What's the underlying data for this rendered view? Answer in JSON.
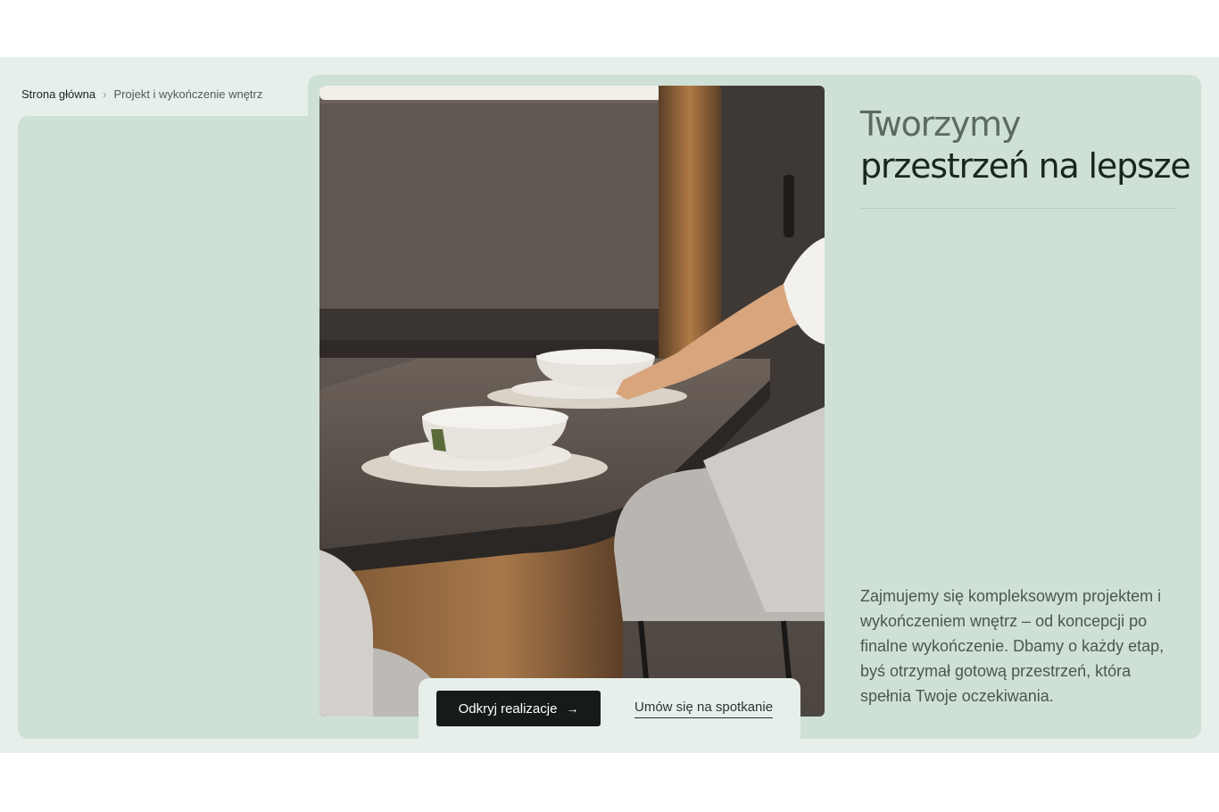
{
  "breadcrumb": {
    "home": "Strona główna",
    "separator_icon": "chevron-right-icon",
    "current": "Projekt i wykończenie wnętrz"
  },
  "hero": {
    "title_line1": "Tworzymy",
    "title_line2": "przestrzeń na lepsze",
    "description": "Zajmujemy się kompleksowym projektem i wykończeniem wnętrz – od koncepcji po finalne wykończenie. Dbamy o każdy etap, byś otrzymał gotową przestrzeń, która spełnia Twoje oczekiwania."
  },
  "cta": {
    "primary_label": "Odkryj realizacje",
    "primary_icon": "arrow-right-icon",
    "secondary_label": "Umów się na spotkanie"
  },
  "colors": {
    "band": "#e7efeb",
    "panel": "#cfe0d6",
    "button": "#151b18"
  }
}
